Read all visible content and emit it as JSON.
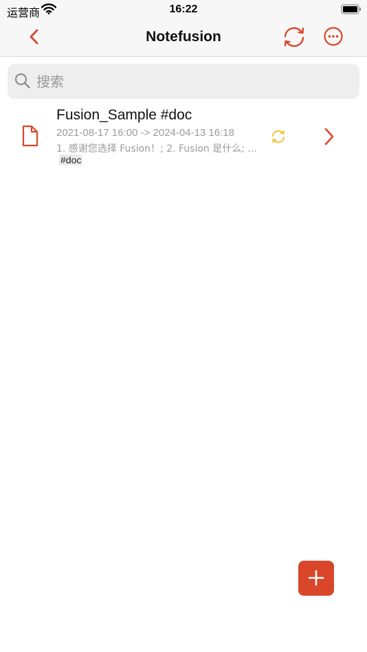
{
  "status_bar": {
    "carrier": "运营商",
    "time": "16:22"
  },
  "nav": {
    "title": "Notefusion",
    "accent_color": "#d9462a"
  },
  "search": {
    "placeholder": "搜索"
  },
  "notes": [
    {
      "title": "Fusion_Sample #doc",
      "date_range": "2021-08-17 16:00 -> 2024-04-13 16:18",
      "summary": "1. 感谢您选择 Fusion！; 2. Fusion 是什么; ...",
      "tag": "#doc",
      "sync_icon_color": "#f0c020"
    }
  ],
  "icons": [
    "chevron-left-icon",
    "sync-icon",
    "more-icon",
    "search-icon",
    "document-icon",
    "chevron-right-icon",
    "plus-icon",
    "wifi-icon",
    "battery-icon"
  ]
}
